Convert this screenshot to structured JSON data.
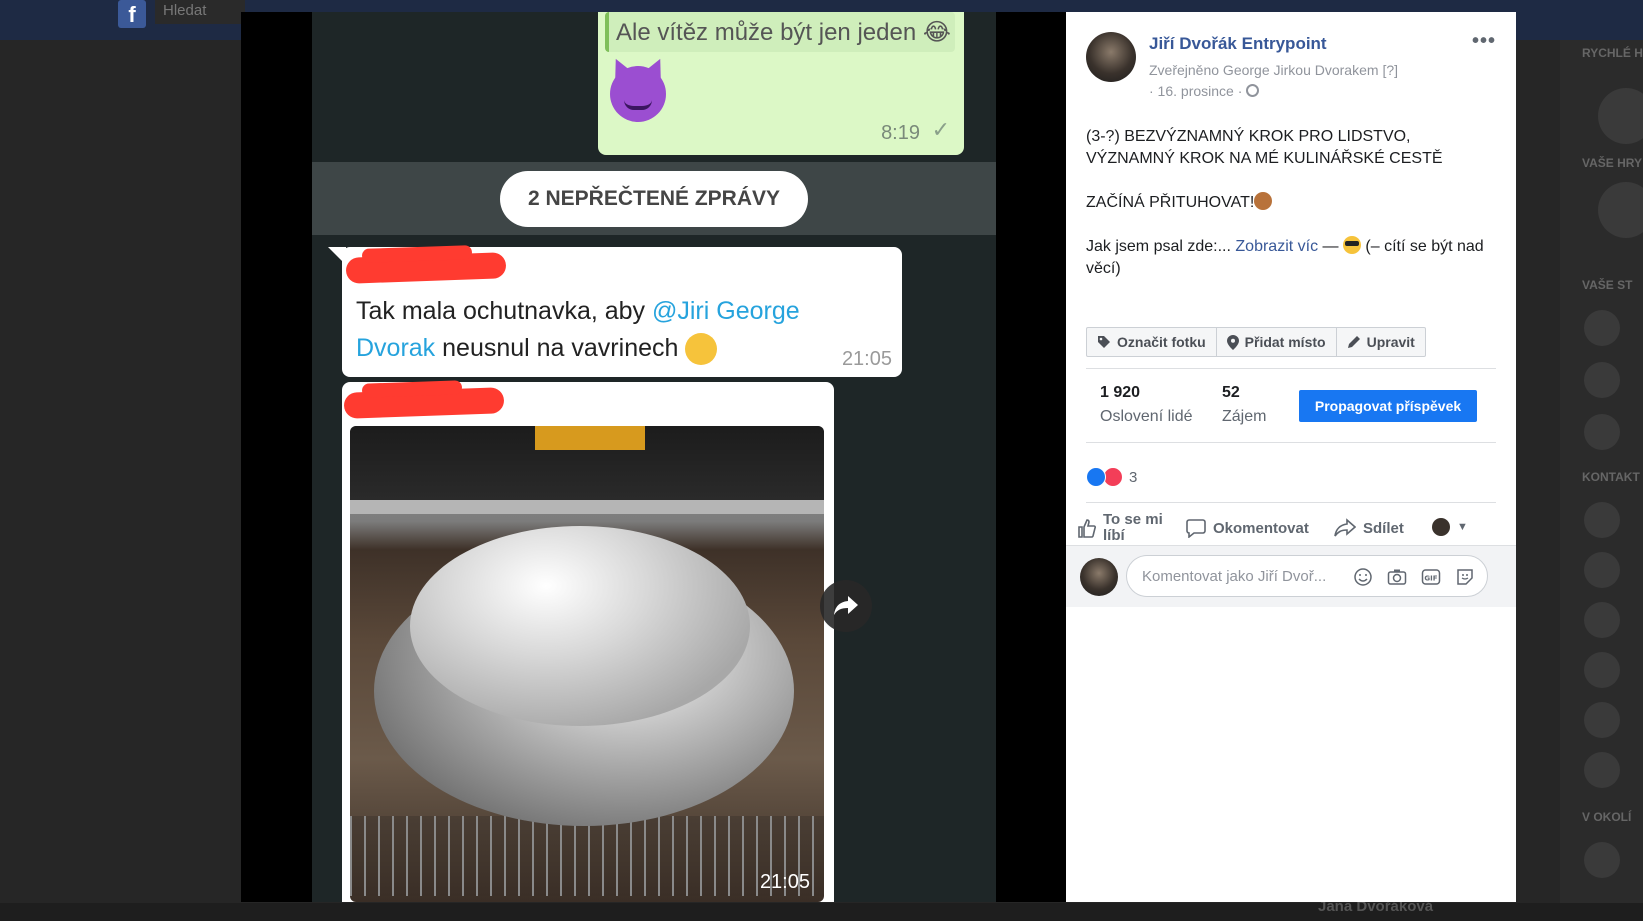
{
  "background": {
    "search_label": "Hledat",
    "bottom_name": "Jana Dvořáková",
    "sidebar_headings": [
      "RYCHLÉ H",
      "VAŠE HRY",
      "VAŠE ST",
      "KONTAKT",
      "V OKOLÍ"
    ]
  },
  "chat_screenshot": {
    "quoted_message": "Ale vítěz může být jen jeden 😂",
    "green_time": "8:19",
    "unread_banner": "2 NEPŘEČTENÉ ZPRÁVY",
    "message": {
      "text_before": "Tak mala ochutnavka, aby ",
      "mention": "@Jiri George Dvorak",
      "text_after": " neusnul na vavrinech",
      "time": "21:05"
    },
    "photo_time": "21:05"
  },
  "post": {
    "author": "Jiří Dvořák Entrypoint",
    "posted_by": "Zveřejněno George Jirkou Dvorakem",
    "posted_by_marker": "[?]",
    "date": "· 16. prosince ·",
    "text_line1": "(3-?) BEZVÝZNAMNÝ KROK PRO LIDSTVO,",
    "text_line2": "VÝZNAMNÝ KROK NA MÉ KULINÁŘSKÉ CESTĚ",
    "text_line3": "ZAČÍNÁ PŘITUHOVAT!",
    "text_line4_prefix": "Jak jsem psal zde:... ",
    "show_more": "Zobrazit víc",
    "feeling_dash": " — ",
    "feeling": "(– cítí se být nad věcí)",
    "actions": {
      "tag_photo": "Označit fotku",
      "add_place": "Přidat místo",
      "edit": "Upravit"
    },
    "stats": {
      "reach_value": "1 920",
      "reach_label": "Oslovení lidé",
      "engagement_value": "52",
      "engagement_label": "Zájem"
    },
    "promote": "Propagovat příspěvek",
    "reaction_count": "3",
    "bar": {
      "like_line1": "To se mi",
      "like_line2": "líbí",
      "comment": "Okomentovat",
      "share": "Sdílet"
    },
    "comment_placeholder": "Komentovat jako Jiří Dvoř..."
  },
  "colors": {
    "fb_link": "#385898",
    "promote_blue": "#1877f2",
    "whatsapp_green": "#dcf8c6",
    "mention_blue": "#26a3dd",
    "redaction_red": "#ff3b30"
  },
  "icons": [
    "devil-emoji",
    "laugh-emoji",
    "check-icon",
    "forward-icon",
    "tag-icon",
    "pin-icon",
    "pencil-icon",
    "more-icon",
    "globe-icon",
    "like-icon",
    "love-icon",
    "comment-icon",
    "share-icon",
    "emoji-icon",
    "camera-icon",
    "gif-icon",
    "sticker-icon"
  ]
}
